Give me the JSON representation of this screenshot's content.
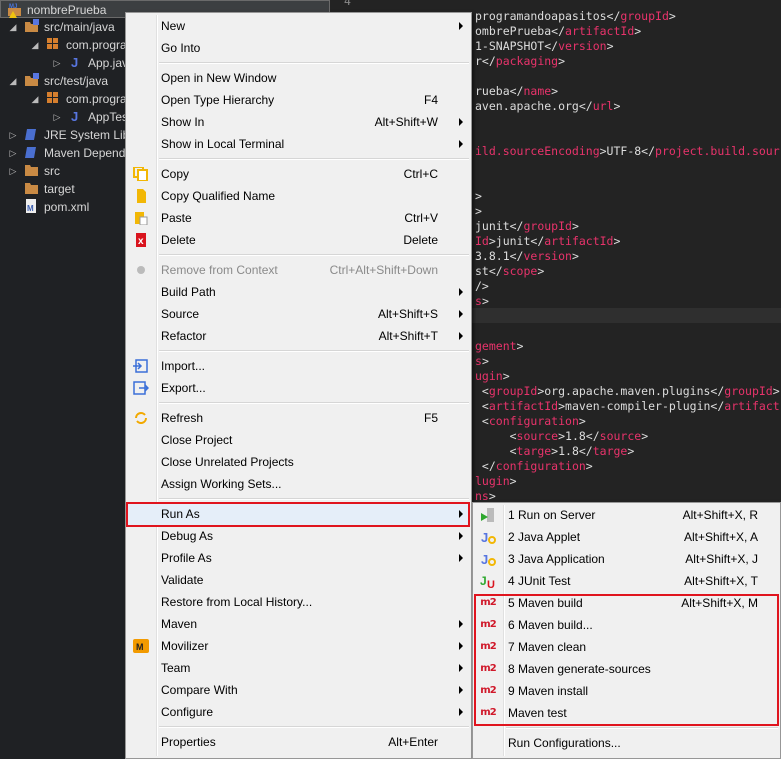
{
  "tree": [
    {
      "label": "nombrePrueba",
      "indent": 0,
      "twisty": "",
      "icon": "maven-project-icon",
      "selected": true
    },
    {
      "label": "src/main/java",
      "indent": 1,
      "twisty": "◢",
      "icon": "source-folder-icon"
    },
    {
      "label": "com.progra",
      "indent": 2,
      "twisty": "◢",
      "icon": "package-icon"
    },
    {
      "label": "App.java",
      "indent": 3,
      "twisty": "▷",
      "icon": "java-file-icon"
    },
    {
      "label": "src/test/java",
      "indent": 1,
      "twisty": "◢",
      "icon": "source-folder-icon"
    },
    {
      "label": "com.progra",
      "indent": 2,
      "twisty": "◢",
      "icon": "package-icon"
    },
    {
      "label": "AppTest",
      "indent": 3,
      "twisty": "▷",
      "icon": "java-file-icon"
    },
    {
      "label": "JRE System Libr",
      "indent": 1,
      "twisty": "▷",
      "icon": "library-icon"
    },
    {
      "label": "Maven Depend",
      "indent": 1,
      "twisty": "▷",
      "icon": "library-icon"
    },
    {
      "label": "src",
      "indent": 1,
      "twisty": "▷",
      "icon": "folder-icon"
    },
    {
      "label": "target",
      "indent": 1,
      "twisty": "",
      "icon": "folder-icon"
    },
    {
      "label": "pom.xml",
      "indent": 1,
      "twisty": "",
      "icon": "pom-file-icon"
    }
  ],
  "editor": {
    "line_number": "4",
    "lines": [
      {
        "row": 0,
        "seg": [
          [
            "programandoapasitos</",
            "t"
          ],
          [
            "groupId",
            "k"
          ],
          [
            ">",
            "t"
          ]
        ]
      },
      {
        "row": 1,
        "seg": [
          [
            "ombrePrueba</",
            "t"
          ],
          [
            "artifactId",
            "k"
          ],
          [
            ">",
            "t"
          ]
        ]
      },
      {
        "row": 2,
        "seg": [
          [
            "1-SNAPSHOT</",
            "t"
          ],
          [
            "version",
            "k"
          ],
          [
            ">",
            "t"
          ]
        ]
      },
      {
        "row": 3,
        "seg": [
          [
            "r</",
            "t"
          ],
          [
            "packaging",
            "k"
          ],
          [
            ">",
            "t"
          ]
        ]
      },
      {
        "row": 5,
        "seg": [
          [
            "rueba</",
            "t"
          ],
          [
            "name",
            "k"
          ],
          [
            ">",
            "t"
          ]
        ]
      },
      {
        "row": 6,
        "seg": [
          [
            "aven.apache.org</",
            "t"
          ],
          [
            "url",
            "k"
          ],
          [
            ">",
            "t"
          ]
        ]
      },
      {
        "row": 9,
        "seg": [
          [
            "ild.sourceEncoding",
            "k"
          ],
          [
            ">UTF-8</",
            "t"
          ],
          [
            "project.build.sour",
            "k"
          ]
        ]
      },
      {
        "row": 12,
        "seg": [
          [
            ">",
            "t"
          ]
        ]
      },
      {
        "row": 13,
        "seg": [
          [
            ">",
            "t"
          ]
        ]
      },
      {
        "row": 14,
        "seg": [
          [
            "junit</",
            "t"
          ],
          [
            "groupId",
            "k"
          ],
          [
            ">",
            "t"
          ]
        ]
      },
      {
        "row": 15,
        "seg": [
          [
            "Id",
            "k"
          ],
          [
            ">junit</",
            "t"
          ],
          [
            "artifactId",
            "k"
          ],
          [
            ">",
            "t"
          ]
        ]
      },
      {
        "row": 16,
        "seg": [
          [
            "3.8.1</",
            "t"
          ],
          [
            "version",
            "k"
          ],
          [
            ">",
            "t"
          ]
        ]
      },
      {
        "row": 17,
        "seg": [
          [
            "st</",
            "t"
          ],
          [
            "scope",
            "k"
          ],
          [
            ">",
            "t"
          ]
        ]
      },
      {
        "row": 18,
        "seg": [
          [
            "/>",
            "t"
          ]
        ]
      },
      {
        "row": 19,
        "seg": [
          [
            "s",
            "k"
          ],
          [
            ">",
            "t"
          ]
        ]
      },
      {
        "row": 22,
        "seg": [
          [
            "gement",
            "k"
          ],
          [
            ">",
            "t"
          ]
        ]
      },
      {
        "row": 23,
        "seg": [
          [
            "s",
            "k"
          ],
          [
            ">",
            "t"
          ]
        ]
      },
      {
        "row": 24,
        "seg": [
          [
            "ugin",
            "k"
          ],
          [
            ">",
            "t"
          ]
        ]
      },
      {
        "row": 25,
        "seg": [
          [
            " <",
            "t"
          ],
          [
            "groupId",
            "k"
          ],
          [
            ">org.apache.maven.plugins</",
            "t"
          ],
          [
            "groupId",
            "k"
          ],
          [
            ">",
            "t"
          ]
        ]
      },
      {
        "row": 26,
        "seg": [
          [
            " <",
            "t"
          ],
          [
            "artifactId",
            "k"
          ],
          [
            ">maven-compiler-plugin</",
            "t"
          ],
          [
            "artifact",
            "k"
          ]
        ]
      },
      {
        "row": 27,
        "seg": [
          [
            " <",
            "t"
          ],
          [
            "configuration",
            "k"
          ],
          [
            ">",
            "t"
          ]
        ]
      },
      {
        "row": 28,
        "seg": [
          [
            "     <",
            "t"
          ],
          [
            "source",
            "k"
          ],
          [
            ">1.8</",
            "t"
          ],
          [
            "source",
            "k"
          ],
          [
            ">",
            "t"
          ]
        ]
      },
      {
        "row": 29,
        "seg": [
          [
            "     <",
            "t"
          ],
          [
            "targe",
            "k"
          ],
          [
            ">1.8</",
            "t"
          ],
          [
            "targe",
            "k"
          ],
          [
            ">",
            "t"
          ]
        ]
      },
      {
        "row": 30,
        "seg": [
          [
            " </",
            "t"
          ],
          [
            "configuration",
            "k"
          ],
          [
            ">",
            "t"
          ]
        ]
      },
      {
        "row": 31,
        "seg": [
          [
            "lugin",
            "k"
          ],
          [
            ">",
            "t"
          ]
        ]
      },
      {
        "row": 32,
        "seg": [
          [
            "ns",
            "k"
          ],
          [
            ">",
            "t"
          ]
        ]
      }
    ]
  },
  "context_menu": {
    "groups": [
      [
        {
          "label": "New",
          "arrow": true
        },
        {
          "label": "Go Into"
        }
      ],
      [
        {
          "label": "Open in New Window"
        },
        {
          "label": "Open Type Hierarchy",
          "shortcut": "F4"
        },
        {
          "label": "Show In",
          "shortcut": "Alt+Shift+W",
          "arrow": true
        },
        {
          "label": "Show in Local Terminal",
          "arrow": true
        }
      ],
      [
        {
          "label": "Copy",
          "shortcut": "Ctrl+C",
          "icon": "copy-icon"
        },
        {
          "label": "Copy Qualified Name",
          "icon": "copy-qualified-name-icon"
        },
        {
          "label": "Paste",
          "shortcut": "Ctrl+V",
          "icon": "paste-icon"
        },
        {
          "label": "Delete",
          "shortcut": "Delete",
          "icon": "delete-icon"
        }
      ],
      [
        {
          "label": "Remove from Context",
          "shortcut": "Ctrl+Alt+Shift+Down",
          "disabled": true,
          "icon": "remove-context-icon"
        },
        {
          "label": "Build Path",
          "arrow": true
        },
        {
          "label": "Source",
          "shortcut": "Alt+Shift+S",
          "arrow": true
        },
        {
          "label": "Refactor",
          "shortcut": "Alt+Shift+T",
          "arrow": true
        }
      ],
      [
        {
          "label": "Import...",
          "icon": "import-icon"
        },
        {
          "label": "Export...",
          "icon": "export-icon"
        }
      ],
      [
        {
          "label": "Refresh",
          "shortcut": "F5",
          "icon": "refresh-icon"
        },
        {
          "label": "Close Project"
        },
        {
          "label": "Close Unrelated Projects"
        },
        {
          "label": "Assign Working Sets..."
        }
      ],
      [
        {
          "label": "Run As",
          "arrow": true,
          "highlight": true
        },
        {
          "label": "Debug As",
          "arrow": true
        },
        {
          "label": "Profile As",
          "arrow": true
        },
        {
          "label": "Validate"
        },
        {
          "label": "Restore from Local History..."
        },
        {
          "label": "Maven",
          "arrow": true
        },
        {
          "label": "Movilizer",
          "arrow": true,
          "icon": "movilizer-icon"
        },
        {
          "label": "Team",
          "arrow": true
        },
        {
          "label": "Compare With",
          "arrow": true
        },
        {
          "label": "Configure",
          "arrow": true
        }
      ],
      [
        {
          "label": "Properties",
          "shortcut": "Alt+Enter"
        }
      ]
    ]
  },
  "run_as_menu": {
    "items": [
      {
        "label": "1 Run on Server",
        "shortcut": "Alt+Shift+X, R",
        "icon": "run-on-server-icon"
      },
      {
        "label": "2 Java Applet",
        "shortcut": "Alt+Shift+X, A",
        "icon": "java-applet-icon"
      },
      {
        "label": "3 Java Application",
        "shortcut": "Alt+Shift+X, J",
        "icon": "java-application-icon"
      },
      {
        "label": "4 JUnit Test",
        "shortcut": "Alt+Shift+X, T",
        "icon": "junit-icon"
      },
      {
        "label": "5 Maven build",
        "shortcut": "Alt+Shift+X, M",
        "icon": "m2-icon"
      },
      {
        "label": "6 Maven build...",
        "icon": "m2-icon"
      },
      {
        "label": "7 Maven clean",
        "icon": "m2-icon"
      },
      {
        "label": "8 Maven generate-sources",
        "icon": "m2-icon"
      },
      {
        "label": "9 Maven install",
        "icon": "m2-icon"
      },
      {
        "label": "Maven test",
        "icon": "m2-icon"
      }
    ],
    "footer": "Run Configurations...",
    "m2_text": "m2"
  },
  "colors": {
    "highlight_border": "#e0141e",
    "xml_tag": "#e8336b"
  }
}
